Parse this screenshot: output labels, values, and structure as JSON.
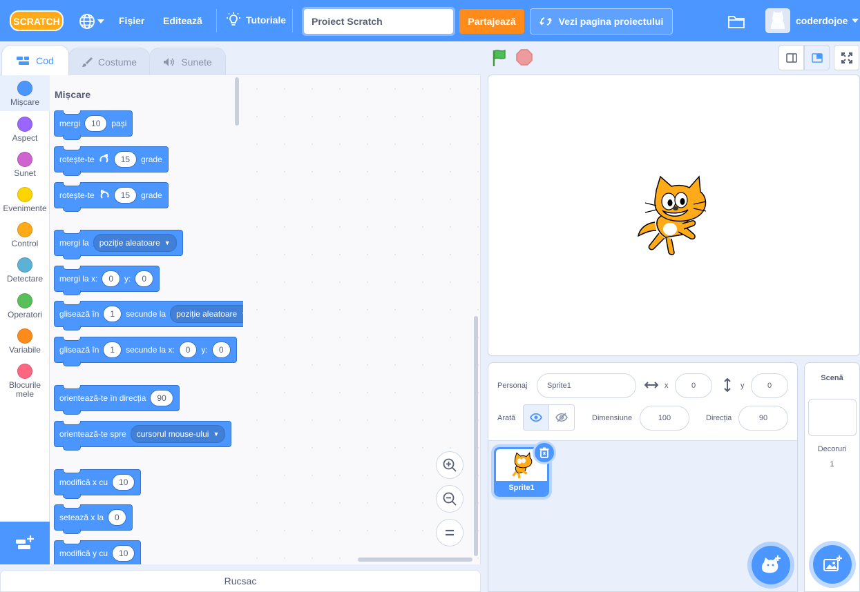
{
  "menubar": {
    "logo_text": "SCRATCH",
    "file": "Fișier",
    "edit": "Editează",
    "tutorials": "Tutoriale",
    "project_title": "Proiect Scratch",
    "share": "Partajează",
    "see_project_page": "Vezi pagina proiectului",
    "username": "coderdojoe"
  },
  "tabs": {
    "code": "Cod",
    "costumes": "Costume",
    "sounds": "Sunete"
  },
  "categories": [
    {
      "label": "Mișcare",
      "color": "#4c97ff"
    },
    {
      "label": "Aspect",
      "color": "#9966ff"
    },
    {
      "label": "Sunet",
      "color": "#cf63cf"
    },
    {
      "label": "Evenimente",
      "color": "#ffd500"
    },
    {
      "label": "Control",
      "color": "#ffab19"
    },
    {
      "label": "Detectare",
      "color": "#5cb1d6"
    },
    {
      "label": "Operatori",
      "color": "#59c059"
    },
    {
      "label": "Variabile",
      "color": "#ff8c1a"
    },
    {
      "label": "Blocurile mele",
      "color": "#ff6680"
    }
  ],
  "palette": {
    "heading": "Mișcare",
    "blocks": {
      "move": {
        "t1": "mergi",
        "v1": "10",
        "t2": "pași"
      },
      "turn_right": {
        "t1": "rotește-te",
        "v1": "15",
        "t2": "grade"
      },
      "turn_left": {
        "t1": "rotește-te",
        "v1": "15",
        "t2": "grade"
      },
      "goto": {
        "t1": "mergi la",
        "dd": "poziție aleatoare"
      },
      "goto_xy": {
        "t1": "mergi la x:",
        "v1": "0",
        "t2": "y:",
        "v2": "0"
      },
      "glide": {
        "t1": "glisează în",
        "v1": "1",
        "t2": "secunde la",
        "dd": "poziție aleatoare"
      },
      "glide_xy": {
        "t1": "glisează în",
        "v1": "1",
        "t2": "secunde la x:",
        "v2": "0",
        "t3": "y:",
        "v3": "0"
      },
      "point_dir": {
        "t1": "orientează-te în direcția",
        "v1": "90"
      },
      "point_towards": {
        "t1": "orientează-te spre",
        "dd": "cursorul mouse-ului"
      },
      "change_x": {
        "t1": "modifică x cu",
        "v1": "10"
      },
      "set_x": {
        "t1": "setează x la",
        "v1": "0"
      },
      "change_y": {
        "t1": "modifică y cu",
        "v1": "10"
      }
    }
  },
  "backpack": "Rucsac",
  "sprite_info": {
    "sprite_label": "Personaj",
    "sprite_name": "Sprite1",
    "x_label": "x",
    "x_value": "0",
    "y_label": "y",
    "y_value": "0",
    "show_label": "Arată",
    "size_label": "Dimensiune",
    "size_value": "100",
    "direction_label": "Direcția",
    "direction_value": "90"
  },
  "sprites": [
    {
      "name": "Sprite1"
    }
  ],
  "stage_pane": {
    "title": "Scenă",
    "backdrops_label": "Decoruri",
    "backdrops_count": "1"
  },
  "colors": {
    "menubar": "#4c97ff",
    "share": "#ff8c1a",
    "motion": "#4c97ff",
    "background": "#e9f0fc"
  }
}
